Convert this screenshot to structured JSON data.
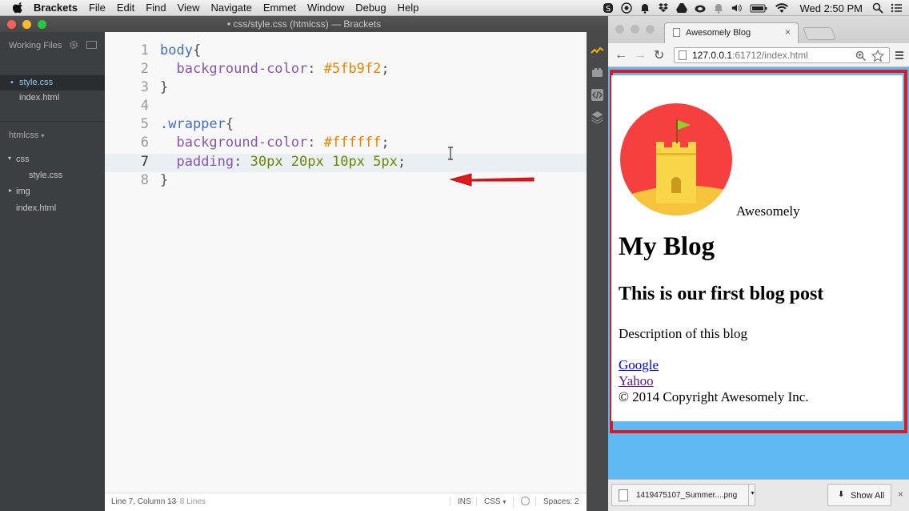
{
  "menubar": {
    "app_name": "Brackets",
    "items": [
      "File",
      "Edit",
      "Find",
      "View",
      "Navigate",
      "Emmet",
      "Window",
      "Debug",
      "Help"
    ],
    "clock": "Wed 2:50 PM",
    "icons": [
      "skype-icon",
      "record-icon",
      "notifications-icon",
      "dropbox-icon",
      "drive-icon",
      "creative-cloud-icon",
      "bell-icon",
      "volume-icon",
      "battery-icon",
      "wifi-icon",
      "spotlight-icon",
      "notification-center-icon"
    ]
  },
  "brackets": {
    "window_title": "• css/style.css (htmlcss) — Brackets",
    "sidebar": {
      "working_files_label": "Working Files",
      "working_files": [
        "style.css",
        "index.html"
      ],
      "project_name": "htmlcss",
      "tree": {
        "css_folder": "css",
        "css_file": "style.css",
        "img_folder": "img",
        "index_file": "index.html"
      }
    },
    "editor": {
      "lines": [
        {
          "n": "1",
          "sel": "body",
          "rest": "{"
        },
        {
          "n": "2",
          "prop": "background-color",
          "colon": ": ",
          "val": "#5fb9f2",
          "end": ";"
        },
        {
          "n": "3",
          "text": "}"
        },
        {
          "n": "4",
          "text": ""
        },
        {
          "n": "5",
          "sel": ".wrapper",
          "rest": "{"
        },
        {
          "n": "6",
          "prop": "background-color",
          "colon": ": ",
          "val": "#ffffff",
          "end": ";"
        },
        {
          "n": "7",
          "prop": "padding",
          "colon": ": ",
          "val": "30px 20px 10px 5px",
          "end": ";"
        },
        {
          "n": "8",
          "text": "}"
        }
      ]
    },
    "status": {
      "position": "Line 7, Column 13",
      "lines": "— 8 Lines",
      "mode": "INS",
      "language": "CSS",
      "spaces": "Spaces: 2"
    }
  },
  "browser": {
    "tab_title": "Awesomely Blog",
    "url_host": "127.0.0.1",
    "url_path": ":61712/index.html",
    "page": {
      "brand": "Awesomely",
      "h1": "My Blog",
      "h2": "This is our first blog post",
      "description": "Description of this blog",
      "link1": "Google",
      "link2": "Yahoo",
      "copyright": "© 2014 Copyright Awesomely Inc."
    },
    "download": {
      "filename": "1419475107_Summer....png",
      "show_all": "Show All"
    }
  },
  "colors": {
    "body_bg": "#5fb9f2",
    "highlight": "#e0191c",
    "arrow": "#e0191c"
  }
}
